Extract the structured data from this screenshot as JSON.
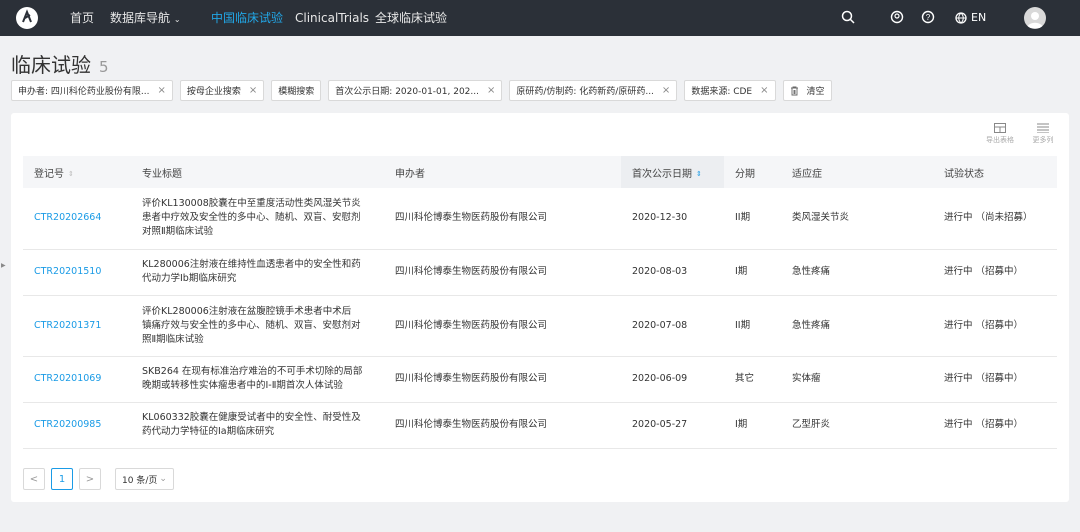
{
  "nav": {
    "home": "首页",
    "db_nav": "数据库导航",
    "cn_trials": "中国临床试验",
    "clinicaltrials": "ClinicalTrials",
    "global_trials": "全球临床试验",
    "lang": "EN"
  },
  "page": {
    "title": "临床试验",
    "count": "5"
  },
  "filters": [
    "申办者: 四川科伦药业股份有限...",
    "按母企业搜索",
    "模糊搜索",
    "首次公示日期: 2020-01-01, 202...",
    "原研药/仿制药: 化药新药/原研药...",
    "数据来源: CDE",
    "清空"
  ],
  "tools": {
    "export": "导出表格",
    "more_cols": "更多列"
  },
  "table": {
    "headers": [
      "登记号",
      "专业标题",
      "申办者",
      "首次公示日期",
      "分期",
      "适应症",
      "试验状态"
    ],
    "rows": [
      {
        "id": "CTR20202664",
        "title": [
          "评价KL130008胶囊在中至重度活动性类风湿关节炎",
          "患者中疗效及安全性的多中心、随机、双盲、安慰剂",
          "对照Ⅱ期临床试验"
        ],
        "sponsor": "四川科伦博泰生物医药股份有限公司",
        "date": "2020-12-30",
        "phase": "II期",
        "indication": "类风湿关节炎",
        "status": "进行中 （尚未招募）"
      },
      {
        "id": "CTR20201510",
        "title": [
          "KL280006注射液在维持性血透患者中的安全性和药",
          "代动力学Ⅰb期临床研究"
        ],
        "sponsor": "四川科伦博泰生物医药股份有限公司",
        "date": "2020-08-03",
        "phase": "I期",
        "indication": "急性疼痛",
        "status": "进行中 （招募中）"
      },
      {
        "id": "CTR20201371",
        "title": [
          "评价KL280006注射液在盆腹腔镜手术患者中术后",
          "镇痛疗效与安全性的多中心、随机、双盲、安慰剂对",
          "照Ⅱ期临床试验"
        ],
        "sponsor": "四川科伦博泰生物医药股份有限公司",
        "date": "2020-07-08",
        "phase": "II期",
        "indication": "急性疼痛",
        "status": "进行中 （招募中）"
      },
      {
        "id": "CTR20201069",
        "title": [
          "SKB264 在现有标准治疗难治的不可手术切除的局部",
          "晚期或转移性实体瘤患者中的Ⅰ-Ⅱ期首次人体试验"
        ],
        "sponsor": "四川科伦博泰生物医药股份有限公司",
        "date": "2020-06-09",
        "phase": "其它",
        "indication": "实体瘤",
        "status": "进行中 （招募中）"
      },
      {
        "id": "CTR20200985",
        "title": [
          "KL060332胶囊在健康受试者中的安全性、耐受性及",
          "药代动力学特征的Ia期临床研究"
        ],
        "sponsor": "四川科伦博泰生物医药股份有限公司",
        "date": "2020-05-27",
        "phase": "I期",
        "indication": "乙型肝炎",
        "status": "进行中 （招募中）"
      }
    ]
  },
  "pager": {
    "prev": "<",
    "current": "1",
    "next": ">",
    "page_size": "10 条/页"
  }
}
